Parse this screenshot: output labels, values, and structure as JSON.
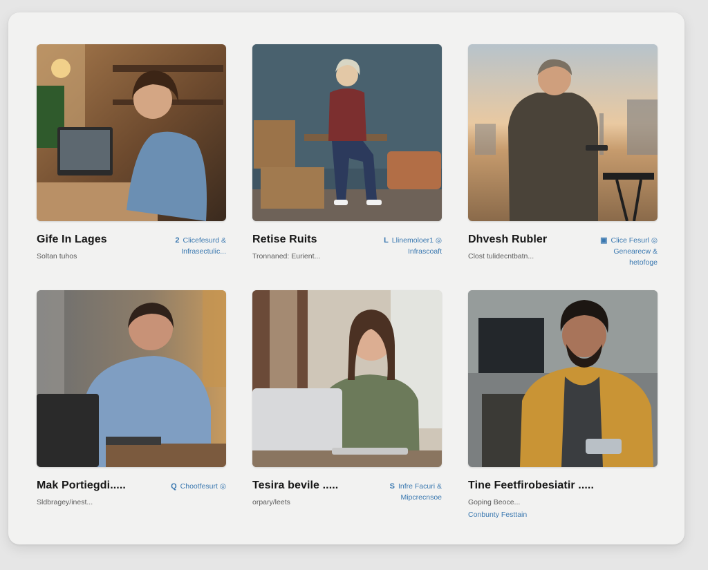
{
  "profiles": [
    {
      "name": "Gife In Lages",
      "subtitle": "Soltan tuhos",
      "extra": "",
      "tag_icon": "2",
      "tag_lines": [
        "Clicefesurd &",
        "Infrasectulic..."
      ]
    },
    {
      "name": "Retise Ruits",
      "subtitle": "Tronnaned: Eurient...",
      "extra": "",
      "tag_icon": "L",
      "tag_lines": [
        "Llinemoloer1 ◎",
        "Infrascoaft"
      ]
    },
    {
      "name": "Dhvesh Rubler",
      "subtitle": "Clost tulidecntbatn...",
      "extra": "",
      "tag_icon": "▣",
      "tag_lines": [
        "Clice Fesurl ◎",
        "Genearecw &",
        "hetofoge"
      ]
    },
    {
      "name": "Mak Portiegdi.....",
      "subtitle": "Sldbragey/inest...",
      "extra": "",
      "tag_icon": "Q",
      "tag_lines": [
        "Chootfesurt ◎"
      ]
    },
    {
      "name": "Tesira bevile .....",
      "subtitle": "orpary/leets",
      "extra": "",
      "tag_icon": "S",
      "tag_lines": [
        "Infre Facuri &",
        "Mipcrecnsoe"
      ]
    },
    {
      "name": "Tine Feetfirobesiatir .....",
      "subtitle": "Goping Beoce...",
      "extra": "Conbunty Festtain",
      "tag_icon": "",
      "tag_lines": []
    }
  ]
}
